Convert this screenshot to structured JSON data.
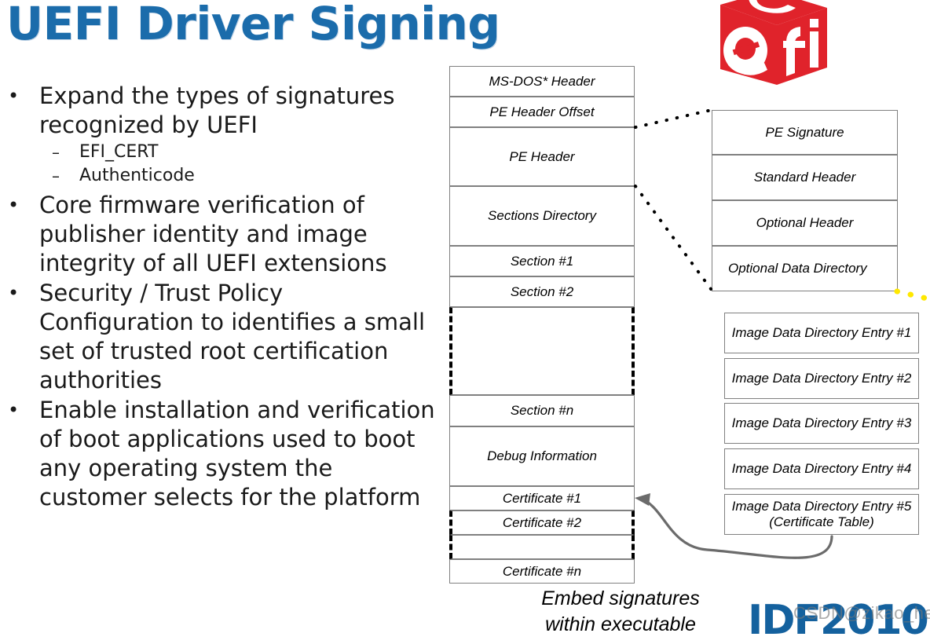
{
  "slide": {
    "title": "UEFI Driver Signing",
    "title_color": "#1b6cab"
  },
  "bullets": [
    {
      "level": 1,
      "marker": "•",
      "text": "Expand the types of signatures recognized by UEFI"
    },
    {
      "level": 2,
      "marker": "–",
      "text": "EFI_CERT"
    },
    {
      "level": 2,
      "marker": "–",
      "text": "Authenticode"
    },
    {
      "level": 1,
      "marker": "•",
      "text": "Core firmware verification of publisher identity and image integrity of all UEFI extensions"
    },
    {
      "level": 1,
      "marker": "•",
      "text": "Security / Trust Policy Configuration to identifies a small set of trusted root certification authorities"
    },
    {
      "level": 1,
      "marker": "•",
      "text": "Enable installation and verification of boot applications used to boot any operating system the customer selects for the platform"
    }
  ],
  "pe_image_column": {
    "boxes": [
      {
        "label": "MS-DOS* Header"
      },
      {
        "label": "PE Header Offset"
      },
      {
        "label": "PE Header"
      },
      {
        "label": "Sections Directory"
      },
      {
        "label": "Section #1"
      },
      {
        "label": "Section #2"
      },
      {
        "label": ""
      },
      {
        "label": "Section #n"
      },
      {
        "label": "Debug Information"
      },
      {
        "label": "Certificate #1"
      },
      {
        "label": "Certificate #2"
      },
      {
        "label": ""
      },
      {
        "label": "Certificate #n"
      }
    ]
  },
  "pe_header_detail": {
    "boxes": [
      {
        "label": "PE Signature"
      },
      {
        "label": "Standard Header"
      },
      {
        "label": "Optional Header"
      },
      {
        "label": "Optional Data Directory"
      }
    ]
  },
  "data_directory": {
    "entries": [
      {
        "label": "Image Data Directory Entry #1"
      },
      {
        "label": "Image Data Directory Entry #2"
      },
      {
        "label": "Image Data Directory Entry #3"
      },
      {
        "label": "Image Data Directory Entry #4"
      },
      {
        "label": "Image Data Directory Entry #5 (Certificate Table)"
      }
    ]
  },
  "caption": {
    "line1": "Embed signatures",
    "line2": "within executable"
  },
  "branding": {
    "uefi_logo_name": "uefi-cube-logo",
    "uefi_logo_color": "#e0232b",
    "idf_logo_text": "IDF2010",
    "idf_logo_color": "#14619e",
    "watermark": "CSDN@zikao_he"
  },
  "connectors": {
    "dotted_color": "#000000",
    "yellow_dotted_color": "#ffe800",
    "arrow_color": "#6b6b6b"
  }
}
